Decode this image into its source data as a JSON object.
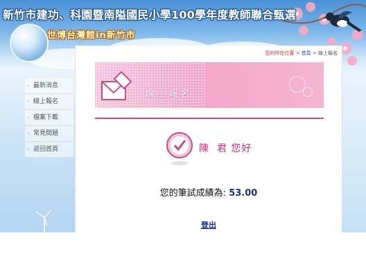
{
  "header": {
    "title": "新竹市建功、科園暨南隘國民小學100學年度教師聯合甄選",
    "subtitle": "世博台灣館in新竹市"
  },
  "sidebar": {
    "items": [
      {
        "label": "最新消息"
      },
      {
        "label": "線上報名"
      },
      {
        "label": "檔案下載"
      },
      {
        "label": "常見問題"
      },
      {
        "label": "返回首頁"
      }
    ]
  },
  "breadcrumb": {
    "label": "您的所在位置",
    "sep": " > ",
    "home": "首頁",
    "current": "線上報名"
  },
  "section": {
    "title": "線上報名"
  },
  "greeting": {
    "name": "陳",
    "suffix": "君 您好"
  },
  "result": {
    "label": "您的筆試成績為:",
    "score": "53.00"
  },
  "actions": {
    "logout": "登出"
  },
  "colors": {
    "accent_pink": "#c44d87",
    "greeting_pink": "#d02a7a",
    "score_blue": "#1c2f8f",
    "link_blue": "#1a2a9c",
    "sky_blue": "#7ab6ea"
  },
  "icons": [
    "school-logo-icon",
    "envelope-pencil-icon",
    "check-badge-icon",
    "magpie-bird-icon",
    "cherry-blossom-icon",
    "windmill-icon"
  ]
}
